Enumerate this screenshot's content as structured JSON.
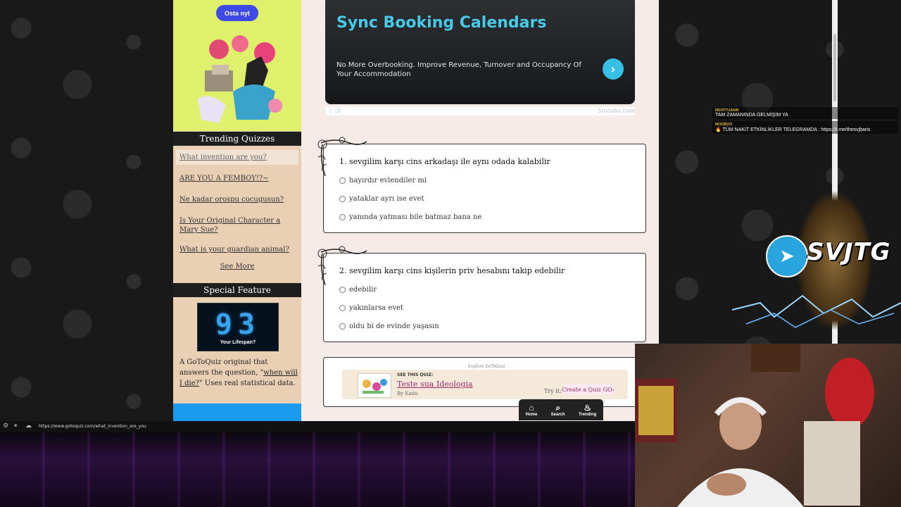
{
  "sidebar": {
    "ad_button": "Osta nyt",
    "trending_title": "Trending Quizzes",
    "trending": [
      "What invention are you?",
      "ARE YOU A FEMBOY!?~",
      "Ne kadar orospu cocugusun?",
      "Is Your Original Character a Mary Sue?",
      "What is your guardian animal?"
    ],
    "see_more": "See More",
    "special_title": "Special Feature",
    "feature_number": "93",
    "feature_caption": "Your Lifespan?",
    "feature_text_before": "A GoToQuiz original that answers the question, \"",
    "feature_link": "when will I die?",
    "feature_text_after": "\" Uses real statistical data."
  },
  "promo": {
    "title": "Sync Booking Calendars",
    "text": "No More Overbooking. Improve Revenue, Turnover and Occupancy Of Your Accommodation",
    "arrow": "›",
    "brand": "Smoobu.com"
  },
  "questions": [
    {
      "title": "1. sevgilim karşı cins arkadaşı ile aynı odada kalabilir",
      "options": [
        "hayırdır evlendiler mi",
        "yataklar ayrı ise evet",
        "yanında yatması bile batmaz bana ne"
      ]
    },
    {
      "title": "2. sevgilim karşı cins kişilerin priv hesabını takip edebilir",
      "options": [
        "edebilir",
        "yakınlarsa evet",
        "oldu bi de evinde yaşasın"
      ]
    }
  ],
  "explore": {
    "label": "Explore GoToQuiz",
    "see_this": "SEE THIS QUIZ:",
    "link": "Teste sua Ideologia",
    "by": "By Kadu",
    "try_it": "Try it:",
    "create": "Create a Quiz GO›"
  },
  "bottom_nav": [
    {
      "label": "Home",
      "icon": "home-icon",
      "glyph": "⌂"
    },
    {
      "label": "Search",
      "icon": "search-icon",
      "glyph": "⌕"
    },
    {
      "label": "Trending",
      "icon": "flame-icon",
      "glyph": "♨"
    }
  ],
  "status": {
    "url": "https://www.gotoquiz.com/what_invention_are_you"
  },
  "chat": [
    {
      "user": "MEHTTIJANIN",
      "message": "TAM ZAMANINDA GELMİŞİM YA"
    },
    {
      "user": "MODIBOO",
      "message": "🔥 TÜM NAKİT ETKİNLİKLER TELEGRAMDA : https://t.me/thesvjbaris"
    }
  ],
  "brand": {
    "text": "SVJTG"
  },
  "colors": {
    "promo_title": "#48c9e8",
    "sidebar_bg": "#e9cfb4",
    "ad_bg": "#dff06c",
    "link": "#a02a6e"
  }
}
